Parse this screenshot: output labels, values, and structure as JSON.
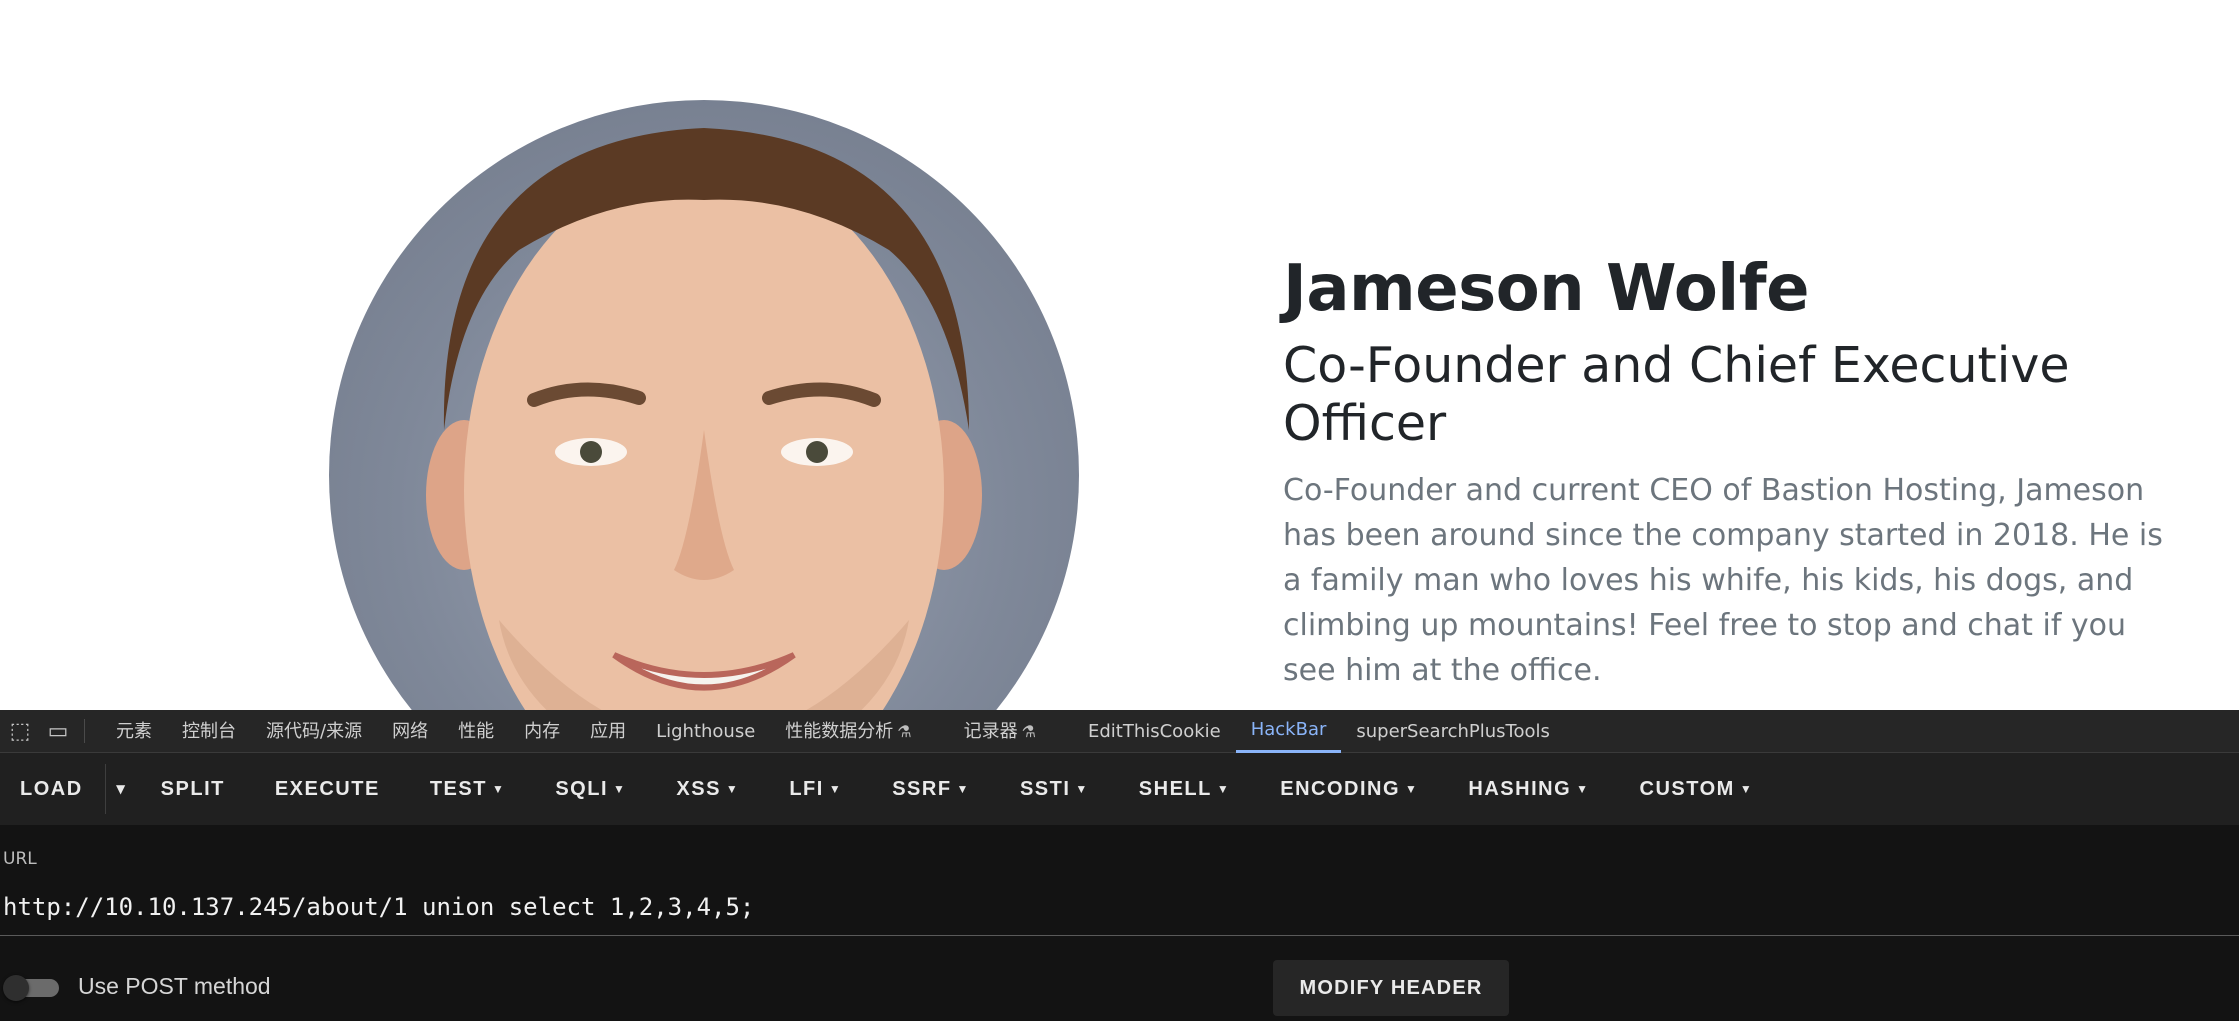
{
  "profile": {
    "name": "Jameson Wolfe",
    "role": "Co-Founder and Chief Executive Officer",
    "bio": "Co-Founder and current CEO of Bastion Hosting, Jameson has been around since the company started in 2018. He is a family man who loves his whife, his kids, his dogs, and climbing up mountains! Feel free to stop and chat if you see him at the office."
  },
  "devtools": {
    "icons": [
      "inspect-icon",
      "device-toolbar-icon"
    ],
    "tabs": [
      {
        "label": "元素"
      },
      {
        "label": "控制台"
      },
      {
        "label": "源代码/来源"
      },
      {
        "label": "网络"
      },
      {
        "label": "性能"
      },
      {
        "label": "内存"
      },
      {
        "label": "应用"
      },
      {
        "label": "Lighthouse"
      },
      {
        "label": "性能数据分析"
      },
      {
        "label": "记录器"
      },
      {
        "label": "EditThisCookie"
      },
      {
        "label": "HackBar"
      },
      {
        "label": "superSearchPlusTools"
      }
    ],
    "active_tab": "HackBar"
  },
  "hackbar": {
    "toolbar": {
      "load": "LOAD",
      "split": "SPLIT",
      "execute": "EXECUTE",
      "test": "TEST",
      "sqli": "SQLI",
      "xss": "XSS",
      "lfi": "LFI",
      "ssrf": "SSRF",
      "ssti": "SSTI",
      "shell": "SHELL",
      "encoding": "ENCODING",
      "hashing": "HASHING",
      "custom": "CUSTOM"
    },
    "url_label": "URL",
    "url_value": "http://10.10.137.245/about/1 union select 1,2,3,4,5;",
    "post_label": "Use POST method",
    "post_enabled": false,
    "modify_header": "MODIFY HEADER"
  },
  "colors": {
    "accent": "#8ab4f8",
    "panel_bg": "#131313",
    "toolbar_bg": "#202020",
    "heading": "#212529",
    "muted": "#6c757d"
  }
}
